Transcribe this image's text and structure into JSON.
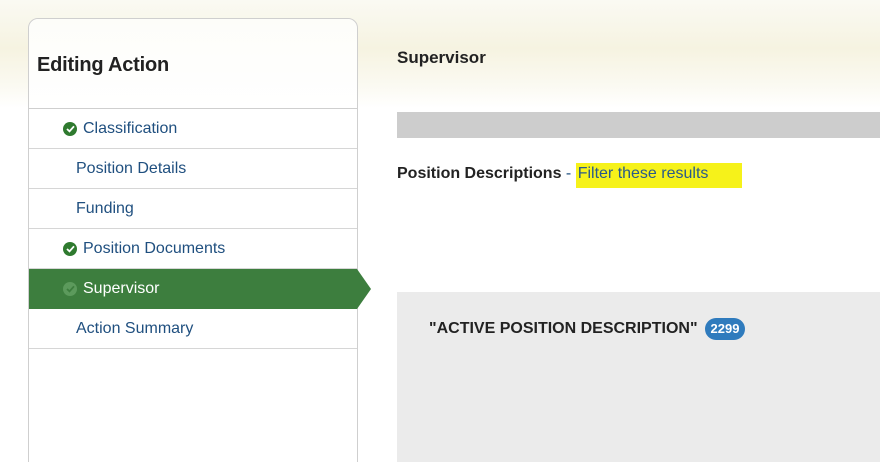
{
  "sidebar": {
    "title": "Editing Action",
    "items": [
      {
        "label": "Classification",
        "checked": true,
        "active": false
      },
      {
        "label": "Position Details",
        "checked": false,
        "active": false
      },
      {
        "label": "Funding",
        "checked": false,
        "active": false
      },
      {
        "label": "Position Documents",
        "checked": true,
        "active": false
      },
      {
        "label": "Supervisor",
        "checked": true,
        "active": true
      },
      {
        "label": "Action Summary",
        "checked": false,
        "active": false
      }
    ]
  },
  "main": {
    "title": "Supervisor",
    "position_descriptions_label": "Position Descriptions",
    "separator": " - ",
    "filter_link": "Filter these results",
    "result": {
      "query": "\"ACTIVE POSITION DESCRIPTION\"",
      "count": "2299"
    }
  },
  "colors": {
    "active_nav_bg": "#3d7e3e",
    "check_icon": "#2f7a2f",
    "link": "#1f4f7f",
    "highlight": "#f6f21a",
    "badge": "#2f7bbd"
  }
}
